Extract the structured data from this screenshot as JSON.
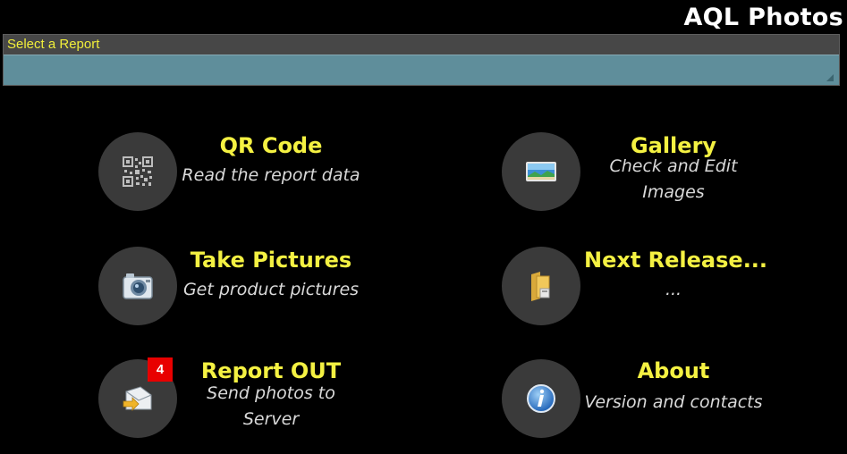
{
  "app": {
    "title": "AQL Photos"
  },
  "report_selector": {
    "label": "Select a Report",
    "value": ""
  },
  "tiles": [
    {
      "id": "qr",
      "title": "QR Code",
      "subtitle": "Read the report data",
      "icon": "qr-code-icon"
    },
    {
      "id": "gallery",
      "title": "Gallery",
      "subtitle": "Check and Edit Images",
      "icon": "gallery-picture-icon"
    },
    {
      "id": "take",
      "title": "Take Pictures",
      "subtitle": "Get product pictures",
      "icon": "camera-icon"
    },
    {
      "id": "next",
      "title": "Next Release...",
      "subtitle": "...",
      "icon": "folder-icon"
    },
    {
      "id": "report_out",
      "title": "Report OUT",
      "subtitle": "Send photos to Server",
      "icon": "envelope-send-icon",
      "badge": "4"
    },
    {
      "id": "about",
      "title": "About",
      "subtitle": "Version and contacts",
      "icon": "info-icon"
    }
  ],
  "colors": {
    "accent": "#f4f142",
    "spinner": "#5f8e9b",
    "badge": "#e80000",
    "circle": "#3a3a3a"
  }
}
